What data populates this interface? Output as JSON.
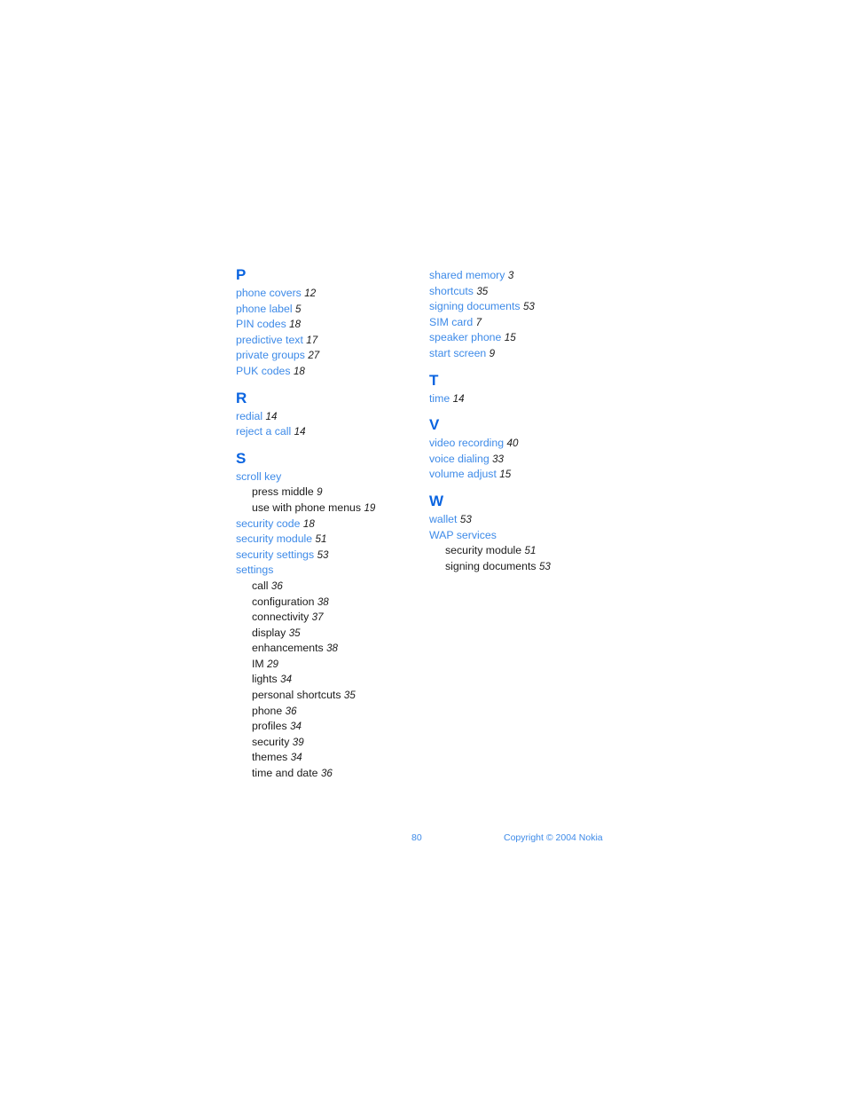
{
  "document": {
    "page_number": "80",
    "copyright": "Copyright © 2004 Nokia"
  },
  "colors": {
    "heading_blue": "#0a64e0",
    "entry_blue": "#3d8ae8",
    "subentry_black": "#1a1a1a",
    "page_background": "#ffffff"
  },
  "columns": [
    {
      "name": "left-column",
      "sections": [
        {
          "heading": "P",
          "entries": [
            {
              "label": "phone covers",
              "page": "12"
            },
            {
              "label": "phone label",
              "page": "5"
            },
            {
              "label": "PIN codes",
              "page": "18"
            },
            {
              "label": "predictive text",
              "page": "17"
            },
            {
              "label": "private groups",
              "page": "27"
            },
            {
              "label": "PUK codes",
              "page": "18"
            }
          ]
        },
        {
          "heading": "R",
          "entries": [
            {
              "label": "redial",
              "page": "14"
            },
            {
              "label": "reject a call",
              "page": "14"
            }
          ]
        },
        {
          "heading": "S",
          "entries": [
            {
              "label": "scroll key",
              "page": "",
              "subentries": [
                {
                  "label": "press middle",
                  "page": "9"
                },
                {
                  "label": "use with phone menus",
                  "page": "19"
                }
              ]
            },
            {
              "label": "security code",
              "page": "18"
            },
            {
              "label": "security module",
              "page": "51"
            },
            {
              "label": "security settings",
              "page": "53"
            },
            {
              "label": "settings",
              "page": "",
              "subentries": [
                {
                  "label": "call",
                  "page": "36"
                },
                {
                  "label": "configuration",
                  "page": "38"
                },
                {
                  "label": "connectivity",
                  "page": "37"
                },
                {
                  "label": "display",
                  "page": "35"
                },
                {
                  "label": "enhancements",
                  "page": "38"
                },
                {
                  "label": "IM",
                  "page": "29"
                },
                {
                  "label": "lights",
                  "page": "34"
                },
                {
                  "label": "personal shortcuts",
                  "page": "35"
                },
                {
                  "label": "phone",
                  "page": "36"
                },
                {
                  "label": "profiles",
                  "page": "34"
                },
                {
                  "label": "security",
                  "page": "39"
                },
                {
                  "label": "themes",
                  "page": "34"
                },
                {
                  "label": "time and date",
                  "page": "36"
                }
              ]
            }
          ]
        }
      ]
    },
    {
      "name": "right-column",
      "sections": [
        {
          "heading": "",
          "entries": [
            {
              "label": "shared memory",
              "page": "3"
            },
            {
              "label": "shortcuts",
              "page": "35"
            },
            {
              "label": "signing documents",
              "page": "53"
            },
            {
              "label": "SIM card",
              "page": "7"
            },
            {
              "label": "speaker phone",
              "page": "15"
            },
            {
              "label": "start screen",
              "page": "9"
            }
          ]
        },
        {
          "heading": "T",
          "entries": [
            {
              "label": "time",
              "page": "14"
            }
          ]
        },
        {
          "heading": "V",
          "entries": [
            {
              "label": "video recording",
              "page": "40"
            },
            {
              "label": "voice dialing",
              "page": "33"
            },
            {
              "label": "volume adjust",
              "page": "15"
            }
          ]
        },
        {
          "heading": "W",
          "entries": [
            {
              "label": "wallet",
              "page": "53"
            },
            {
              "label": "WAP services",
              "page": "",
              "subentries": [
                {
                  "label": "security module",
                  "page": "51"
                },
                {
                  "label": "signing documents",
                  "page": "53"
                }
              ]
            }
          ]
        }
      ]
    }
  ]
}
